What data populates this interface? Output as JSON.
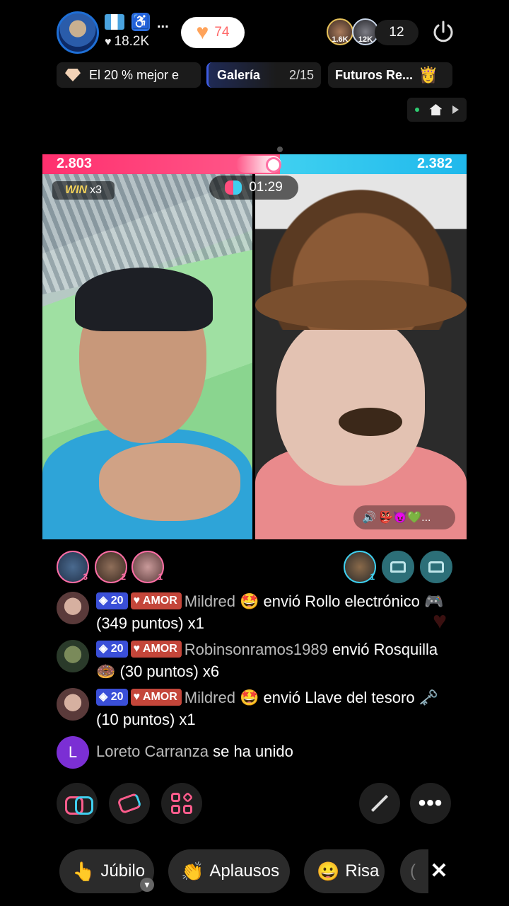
{
  "host": {
    "likes": "18.2K",
    "dots": "...",
    "heart_count": "74",
    "heart_icon": "heart-icon",
    "access_icon": "♿"
  },
  "viewers": {
    "avatar1_badge": "1.6K",
    "avatar2_badge": "12K",
    "count": "12"
  },
  "pills": {
    "rank_text": "El 20 % mejor e",
    "gallery_label": "Galería",
    "gallery_page": "2/15",
    "future_label": "Futuros Re...",
    "crown": "👸"
  },
  "battle": {
    "score_left": "2.803",
    "score_right": "2.382",
    "win_label": "WIN",
    "win_mult": "x3",
    "timer": "01:29",
    "gift_strip": "🔊 👺😈💚..."
  },
  "supporters": {
    "left_ranks": [
      "3",
      "2",
      "1"
    ],
    "right_rank": "1"
  },
  "chat": [
    {
      "level": "20",
      "badge": "AMOR",
      "user": "Mildred 🤩",
      "text": " envió Rollo electrónico 🎮 (349 puntos) x1"
    },
    {
      "level": "20",
      "badge": "AMOR",
      "user": "Robinsonramos1989",
      "text": " envió Rosquilla 🍩 (30 puntos) x6"
    },
    {
      "level": "20",
      "badge": "AMOR",
      "user": "Mildred 🤩",
      "text": " envió Llave del tesoro 🗝️ (10 puntos) x1"
    },
    {
      "initial": "L",
      "user": "Loreto Carranza",
      "text": " se ha unido"
    }
  ],
  "actions": {
    "more": "•••"
  },
  "reactions": {
    "jubilo": "Júbilo",
    "aplausos": "Aplausos",
    "risa": "Risa",
    "partial": "(",
    "close": "✕",
    "jubilo_icon": "👆",
    "aplausos_icon": "👏",
    "risa_icon": "😀"
  },
  "colors": {
    "red_team": "#ff2f6e",
    "blue_team": "#1fb8ec"
  }
}
